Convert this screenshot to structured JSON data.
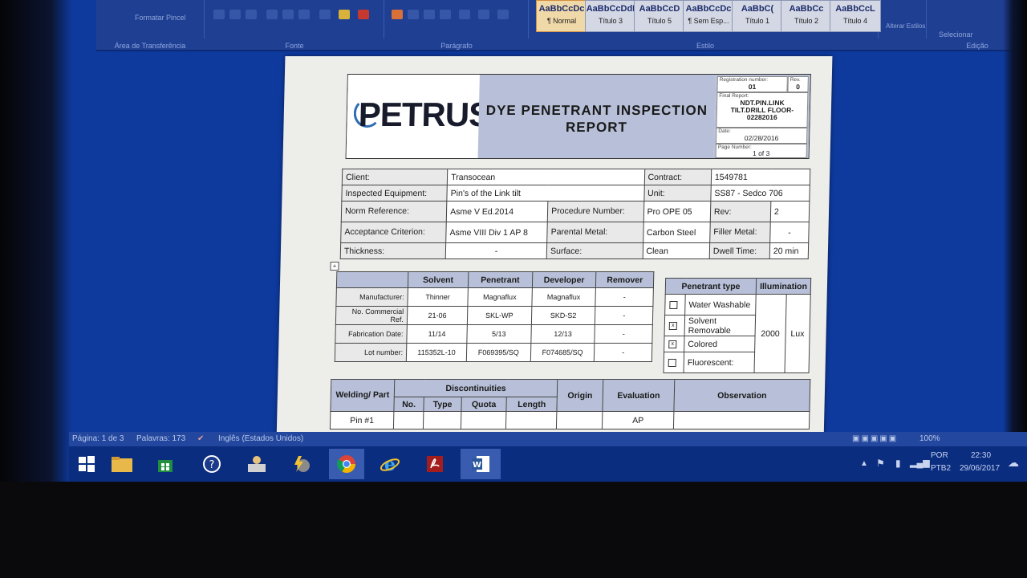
{
  "ribbon": {
    "clipboard_label": "Área de Transferência",
    "format_painter": "Formatar Pincel",
    "font_label": "Fonte",
    "paragraph_label": "Parágrafo",
    "styles_label": "Estilo",
    "edit_label": "Edição",
    "change_styles": "Alterar Estilos",
    "select": "Selecionar",
    "styles": [
      {
        "sample": "AaBbCcDc",
        "name": "¶ Normal"
      },
      {
        "sample": "AaBbCcDdI",
        "name": "Título 3"
      },
      {
        "sample": "AaBbCcD",
        "name": "Título 5"
      },
      {
        "sample": "AaBbCcDc",
        "name": "¶ Sem Esp..."
      },
      {
        "sample": "AaBbC(",
        "name": "Título 1"
      },
      {
        "sample": "AaBbCc",
        "name": "Título 2"
      },
      {
        "sample": "AaBbCcL",
        "name": "Título 4"
      }
    ]
  },
  "report": {
    "logo": "PETRUS",
    "title_line1": "DYE PENETRANT INSPECTION",
    "title_line2": "REPORT",
    "registration_label": "Registration number:",
    "registration_value": "01",
    "rev_label": "Rev.",
    "rev_value": "0",
    "final_report_label": "Final Report:",
    "final_report_value": "NDT.PIN.LINK TILT.DRILL FLOOR-02282016",
    "date_label": "Date:",
    "date_value": "02/28/2016",
    "page_label": "Page Number:",
    "page_value": "1 of 3"
  },
  "info": {
    "client_label": "Client:",
    "client": "Transocean",
    "contract_label": "Contract:",
    "contract": "1549781",
    "equipment_label": "Inspected Equipment:",
    "equipment": "Pin's of the Link tilt",
    "unit_label": "Unit:",
    "unit": "SS87 - Sedco 706",
    "norm_label": "Norm Reference:",
    "norm": "Asme V Ed.2014",
    "procedure_label": "Procedure Number:",
    "procedure": "Pro OPE 05",
    "rev_label": "Rev:",
    "rev": "2",
    "acceptance_label": "Acceptance Criterion:",
    "acceptance": "Asme VIII Div 1 AP 8",
    "parental_label": "Parental Metal:",
    "parental": "Carbon Steel",
    "filler_label": "Filler Metal:",
    "filler": "-",
    "thickness_label": "Thickness:",
    "thickness": "-",
    "surface_label": "Surface:",
    "surface": "Clean",
    "dwell_label": "Dwell Time:",
    "dwell": "20 min"
  },
  "materials": {
    "headers": [
      "",
      "Solvent",
      "Penetrant",
      "Developer",
      "Remover"
    ],
    "rows": [
      [
        "Manufacturer:",
        "Thinner",
        "Magnaflux",
        "Magnaflux",
        "-"
      ],
      [
        "No. Commercial Ref.",
        "21-06",
        "SKL-WP",
        "SKD-S2",
        "-"
      ],
      [
        "Fabrication Date:",
        "11/14",
        "5/13",
        "12/13",
        "-"
      ],
      [
        "Lot number:",
        "115352L-10",
        "F069395/SQ",
        "F074685/SQ",
        "-"
      ]
    ]
  },
  "penetrant": {
    "type_header": "Penetrant type",
    "illum_header": "Illumination",
    "illum_value": "2000",
    "illum_unit": "Lux",
    "types": [
      {
        "label": "Water Washable",
        "mark": ""
      },
      {
        "label": "Solvent Removable",
        "mark": "x"
      },
      {
        "label": "Colored",
        "mark": "x"
      },
      {
        "label": "Fluorescent:",
        "mark": ""
      }
    ]
  },
  "results": {
    "welding_header": "Welding/ Part",
    "disc_header": "Discontinuities",
    "no_header": "No.",
    "type_header": "Type",
    "quota_header": "Quota",
    "length_header": "Length",
    "origin_header": "Origin",
    "evaluation_header": "Evaluation",
    "observation_header": "Observation",
    "row1_part": "Pin #1",
    "row1_eval": "AP"
  },
  "status": {
    "page": "Página: 1 de 3",
    "words": "Palavras: 173",
    "language": "Inglês (Estados Unidos)",
    "zoom": "100%"
  },
  "tray": {
    "lang1": "POR",
    "lang2": "PTB2",
    "time": "22:30",
    "date": "29/06/2017"
  }
}
